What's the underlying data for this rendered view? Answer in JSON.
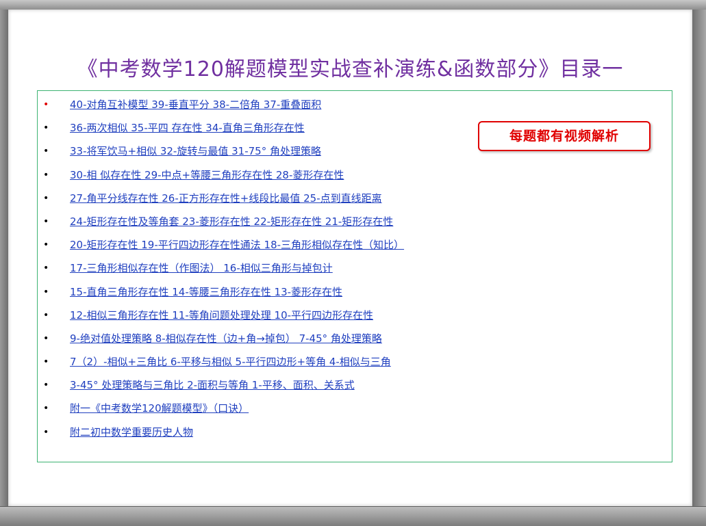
{
  "document": {
    "title": "《中考数学120解题模型实战查补演练&函数部分》目录一",
    "badge": "每题都有视频解析",
    "colors": {
      "title": "#7030a0",
      "link": "#1f3fbf",
      "badge": "#e00000",
      "box_border": "#3cb371",
      "first_bullet": "#e00000"
    },
    "items": [
      {
        "bullet": "•",
        "text": "40-对角互补模型 39-垂直平分 38-二倍角 37-重叠面积"
      },
      {
        "bullet": "•",
        "text": "36-两次相似 35-平四 存在性 34-直角三角形存在性"
      },
      {
        "bullet": "•",
        "text": "33-将军饮马+相似 32-旋转与最值 31-75° 角处理策略"
      },
      {
        "bullet": "•",
        "text": "30-相 似存在性 29-中点+等腰三角形存在性 28-菱形存在性"
      },
      {
        "bullet": "•",
        "text": "27-角平分线存在性 26-正方形存在性+线段比最值 25-点到直线距离"
      },
      {
        "bullet": "•",
        "text": "24-矩形存在性及等角套 23-菱形存在性 22-矩形存在性 21-矩形存在性"
      },
      {
        "bullet": "•",
        "text": "20-矩形存在性 19-平行四边形存在性通法 18-三角形相似存在性（知比）"
      },
      {
        "bullet": "•",
        "text": "17-三角形相似存在性（作图法） 16-相似三角形与掉包计"
      },
      {
        "bullet": "•",
        "text": "15-直角三角形存在性 14-等腰三角形存在性 13-菱形存在性"
      },
      {
        "bullet": "•",
        "text": "12-相似三角形存在性 11-等角问题处理处理 10-平行四边形存在性"
      },
      {
        "bullet": "•",
        "text": "9-绝对值处理策略 8-相似存在性（边+角→掉包） 7-45° 角处理策略"
      },
      {
        "bullet": "•",
        "text": "7（2）-相似+三角比 6-平移与相似 5-平行四边形+等角 4-相似与三角"
      },
      {
        "bullet": "•",
        "text": "3-45° 处理策略与三角比 2-面积与等角 1-平移、面积、关系式"
      },
      {
        "bullet": "•",
        "text": "附一《中考数学120解题模型》（口诀）"
      },
      {
        "bullet": "•",
        "text": "附二初中数学重要历史人物"
      }
    ]
  }
}
